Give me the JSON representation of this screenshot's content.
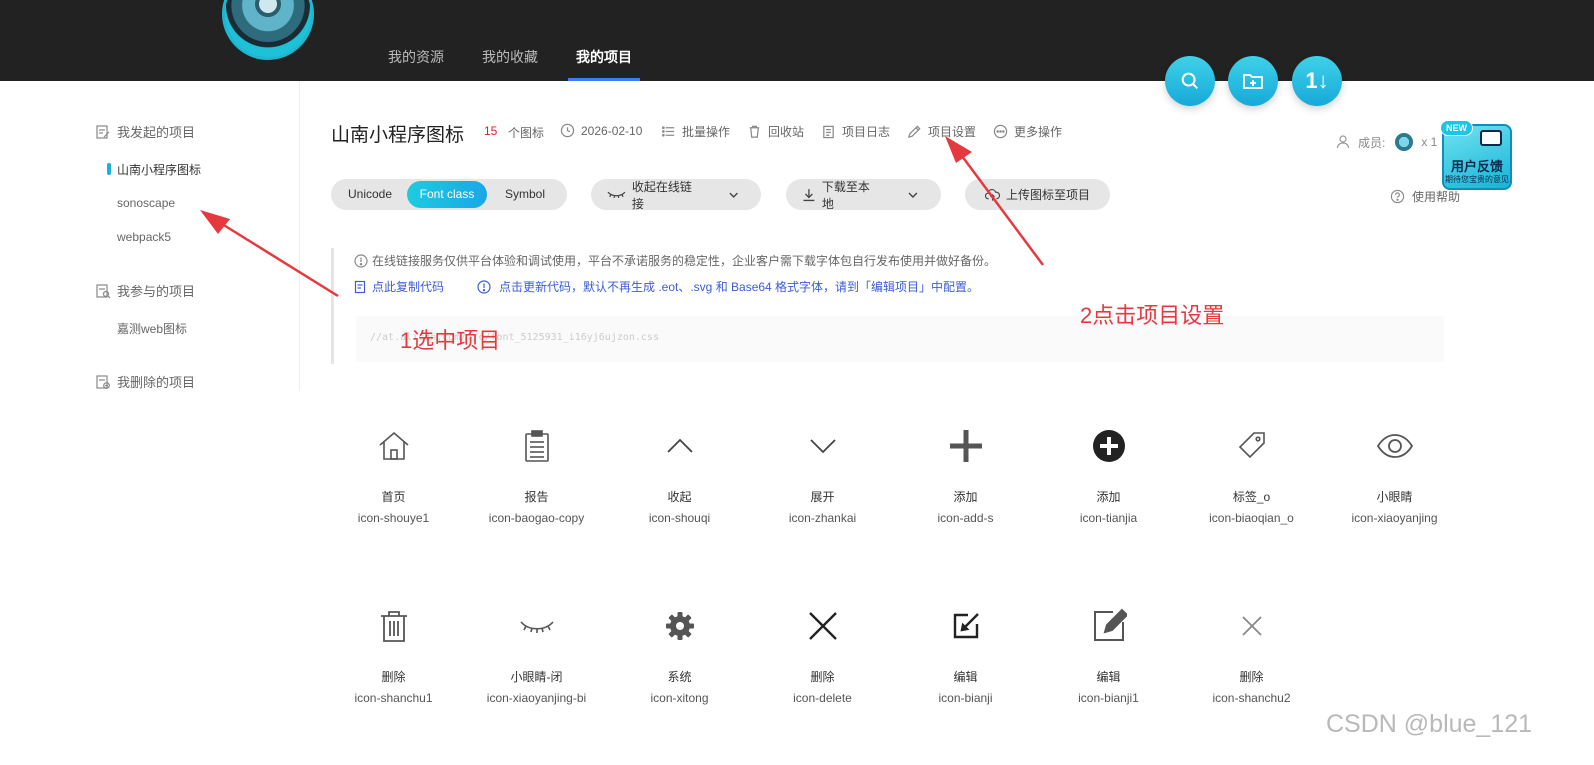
{
  "nav": {
    "tabs": [
      {
        "label": "我的资源"
      },
      {
        "label": "我的收藏"
      },
      {
        "label": "我的项目",
        "active": true
      }
    ]
  },
  "fabs": [
    {
      "icon": "search-icon"
    },
    {
      "icon": "folder-add-icon"
    },
    {
      "icon": "sort-icon",
      "label": "1↓"
    }
  ],
  "sidebar": {
    "initiated_title": "我发起的项目",
    "initiated_items": [
      "山南小程序图标",
      "sonoscape",
      "webpack5"
    ],
    "joined_title": "我参与的项目",
    "joined_items": [
      "嘉测web图标"
    ],
    "deleted_title": "我删除的项目"
  },
  "project": {
    "title": "山南小程序图标",
    "icon_count": "15",
    "icon_count_label": "个图标",
    "date": "2026-02-10",
    "actions": [
      "批量操作",
      "回收站",
      "项目日志",
      "项目设置",
      "更多操作"
    ],
    "member_label": "成员:",
    "member_count": "x 1",
    "help_label": "使用帮助"
  },
  "feedback": {
    "badge": "NEW",
    "title": "用户反馈",
    "subtitle": "期待您宝贵的意见"
  },
  "toolbar": {
    "segments": [
      "Unicode",
      "Font class",
      "Symbol"
    ],
    "active_segment": "Font class",
    "collapse_link_label": "收起在线链接",
    "download_label": "下载至本地",
    "upload_label": "上传图标至项目"
  },
  "notice": {
    "warning": "在线链接服务仅供平台体验和调试使用，平台不承诺服务的稳定性，企业客户需下载字体包自行发布使用并做好备份。",
    "copy_code": "点此复制代码",
    "update_code": "点击更新代码，默认不再生成 .eot、.svg 和 Base64 格式字体，请到「编辑项目」中配置。",
    "code_snippet": "//at.alicdn.com/t/c/font_5125931_i16yj6ujzon.css"
  },
  "annotations": {
    "step1": "1选中项目",
    "step2": "2点击项目设置",
    "color": "#e5393f"
  },
  "icons": [
    {
      "name": "首页",
      "code": "icon-shouye1",
      "glyph": "home-icon"
    },
    {
      "name": "报告",
      "code": "icon-baogao-copy",
      "glyph": "report-icon"
    },
    {
      "name": "收起",
      "code": "icon-shouqi",
      "glyph": "chevron-up-icon"
    },
    {
      "name": "展开",
      "code": "icon-zhankai",
      "glyph": "chevron-down-icon"
    },
    {
      "name": "添加",
      "code": "icon-add-s",
      "glyph": "plus-icon"
    },
    {
      "name": "添加",
      "code": "icon-tianjia",
      "glyph": "plus-circle-icon"
    },
    {
      "name": "标签_o",
      "code": "icon-biaoqian_o",
      "glyph": "tag-icon"
    },
    {
      "name": "小眼睛",
      "code": "icon-xiaoyanjing",
      "glyph": "eye-icon"
    },
    {
      "name": "删除",
      "code": "icon-shanchu1",
      "glyph": "trash-icon"
    },
    {
      "name": "小眼睛-闭",
      "code": "icon-xiaoyanjing-bi",
      "glyph": "eye-closed-icon"
    },
    {
      "name": "系统",
      "code": "icon-xitong",
      "glyph": "gear-icon"
    },
    {
      "name": "删除",
      "code": "icon-delete",
      "glyph": "close-icon"
    },
    {
      "name": "编辑",
      "code": "icon-bianji",
      "glyph": "edit-icon"
    },
    {
      "name": "编辑",
      "code": "icon-bianji1",
      "glyph": "edit-box-icon"
    },
    {
      "name": "删除",
      "code": "icon-shanchu2",
      "glyph": "close-thin-icon"
    }
  ],
  "watermark": "CSDN @blue_121"
}
